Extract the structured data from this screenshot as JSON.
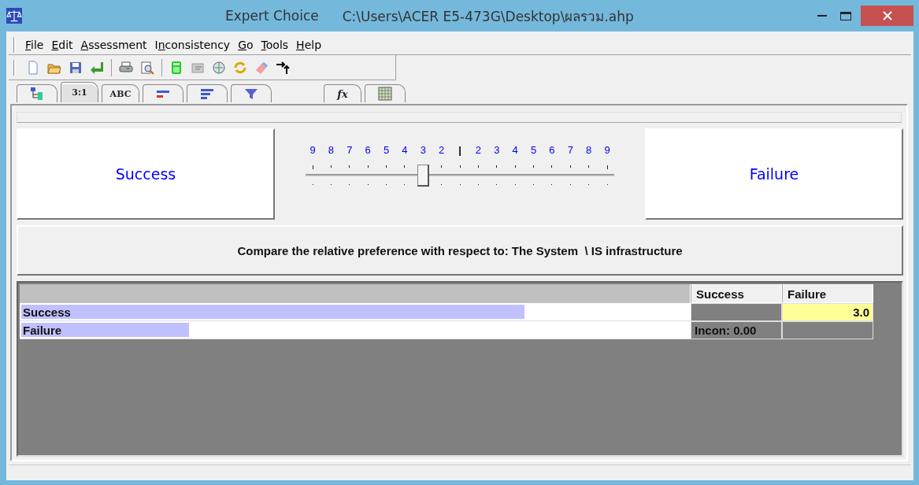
{
  "window": {
    "title": "Expert Choice",
    "path": "C:\\Users\\ACER E5-473G\\Desktop\\ผลรวม.ahp"
  },
  "menu": [
    {
      "key": "F",
      "rest": "ile"
    },
    {
      "key": "E",
      "rest": "dit"
    },
    {
      "key": "A",
      "rest": "ssessment"
    },
    {
      "lead": "I",
      "key": "n",
      "rest": "consistency"
    },
    {
      "key": "G",
      "rest": "o"
    },
    {
      "key": "T",
      "rest": "ools"
    },
    {
      "key": "H",
      "rest": "elp"
    }
  ],
  "tabs": [
    {
      "kind": "icon",
      "selected": false
    },
    {
      "kind": "text",
      "label": "3:1",
      "selected": true
    },
    {
      "kind": "text",
      "label": "ABC",
      "selected": false
    },
    {
      "kind": "icon",
      "selected": false
    },
    {
      "kind": "icon",
      "selected": false
    },
    {
      "kind": "icon",
      "selected": false
    },
    {
      "kind": "formula",
      "label": "fx",
      "selected": false
    },
    {
      "kind": "icon",
      "selected": false
    }
  ],
  "comparison": {
    "left": "Success",
    "right": "Failure",
    "scale": [
      "9",
      "8",
      "7",
      "6",
      "5",
      "4",
      "3",
      "2",
      "|",
      "2",
      "3",
      "4",
      "5",
      "6",
      "7",
      "8",
      "9"
    ],
    "level": 0.375,
    "prompt": "Compare the relative preference with respect to: The System  \\ IS infrastructure"
  },
  "table": {
    "columns": [
      "Success",
      "Failure"
    ],
    "rows": [
      {
        "name": "Success",
        "level": 0.75,
        "cells": [
          {
            "kind": "empty"
          },
          {
            "kind": "entered",
            "text": "3.0"
          }
        ]
      },
      {
        "name": "Failure",
        "level": 0.25,
        "cells": [
          {
            "kind": "note",
            "text": "Incon: 0.00"
          },
          {
            "kind": "empty"
          }
        ]
      }
    ]
  }
}
